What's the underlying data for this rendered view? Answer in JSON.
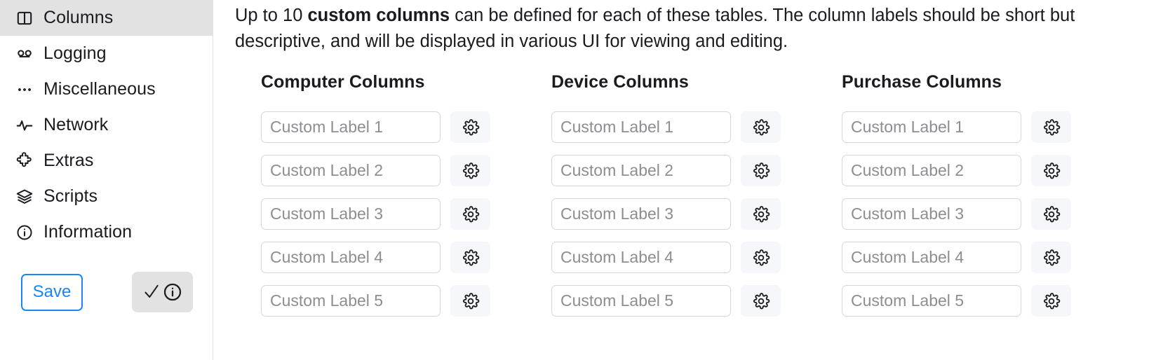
{
  "sidebar": {
    "items": [
      {
        "label": "Columns",
        "icon": "columns-icon",
        "active": true
      },
      {
        "label": "Logging",
        "icon": "logging-icon",
        "active": false
      },
      {
        "label": "Miscellaneous",
        "icon": "ellipsis-icon",
        "active": false
      },
      {
        "label": "Network",
        "icon": "activity-pulse-icon",
        "active": false
      },
      {
        "label": "Extras",
        "icon": "puzzle-piece-icon",
        "active": false
      },
      {
        "label": "Scripts",
        "icon": "layers-stack-icon",
        "active": false
      },
      {
        "label": "Information",
        "icon": "info-circle-icon",
        "active": false
      }
    ],
    "save_label": "Save",
    "verify_icon": "check-info-icon",
    "accent_color": "#1a86f5",
    "active_background": "#e2e2e2"
  },
  "main": {
    "description": {
      "prefix": "Up to 10 ",
      "bold": "custom columns",
      "suffix": " can be defined for each of these tables. The column labels should be short but descriptive, and will be displayed in various UI for viewing and editing."
    },
    "groups": [
      {
        "title": "Computer Columns",
        "fields": [
          {
            "value": "",
            "placeholder": "Custom Label 1",
            "gear_icon": "gear-icon"
          },
          {
            "value": "",
            "placeholder": "Custom Label 2",
            "gear_icon": "gear-icon"
          },
          {
            "value": "",
            "placeholder": "Custom Label 3",
            "gear_icon": "gear-icon"
          },
          {
            "value": "",
            "placeholder": "Custom Label 4",
            "gear_icon": "gear-icon"
          },
          {
            "value": "",
            "placeholder": "Custom Label 5",
            "gear_icon": "gear-icon"
          }
        ]
      },
      {
        "title": "Device Columns",
        "fields": [
          {
            "value": "",
            "placeholder": "Custom Label 1",
            "gear_icon": "gear-icon"
          },
          {
            "value": "",
            "placeholder": "Custom Label 2",
            "gear_icon": "gear-icon"
          },
          {
            "value": "",
            "placeholder": "Custom Label 3",
            "gear_icon": "gear-icon"
          },
          {
            "value": "",
            "placeholder": "Custom Label 4",
            "gear_icon": "gear-icon"
          },
          {
            "value": "",
            "placeholder": "Custom Label 5",
            "gear_icon": "gear-icon"
          }
        ]
      },
      {
        "title": "Purchase Columns",
        "fields": [
          {
            "value": "",
            "placeholder": "Custom Label 1",
            "gear_icon": "gear-icon"
          },
          {
            "value": "",
            "placeholder": "Custom Label 2",
            "gear_icon": "gear-icon"
          },
          {
            "value": "",
            "placeholder": "Custom Label 3",
            "gear_icon": "gear-icon"
          },
          {
            "value": "",
            "placeholder": "Custom Label 4",
            "gear_icon": "gear-icon"
          },
          {
            "value": "",
            "placeholder": "Custom Label 5",
            "gear_icon": "gear-icon"
          }
        ]
      }
    ]
  }
}
